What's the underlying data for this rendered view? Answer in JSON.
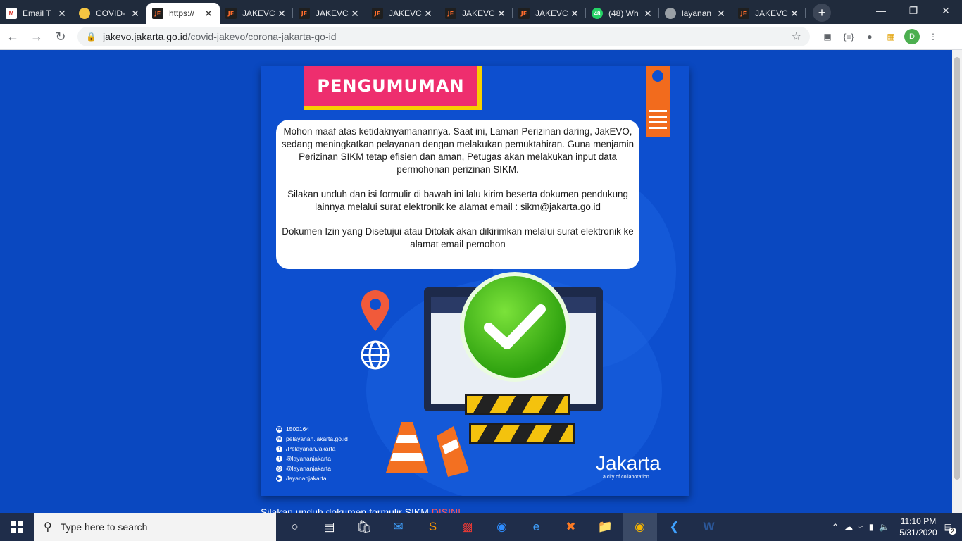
{
  "tabs": [
    {
      "title": "Email T",
      "icon": "gmail-icon",
      "fav": "M",
      "active": false
    },
    {
      "title": "COVID-",
      "icon": "jakarta-seal-icon",
      "fav": "",
      "active": false
    },
    {
      "title": "https://",
      "icon": "jakevo-icon",
      "fav": "JE",
      "active": true
    },
    {
      "title": "JAKEVC",
      "icon": "jakevo-icon",
      "fav": "JE",
      "active": false
    },
    {
      "title": "JAKEVC",
      "icon": "jakevo-icon",
      "fav": "JE",
      "active": false
    },
    {
      "title": "JAKEVC",
      "icon": "jakevo-icon",
      "fav": "JE",
      "active": false
    },
    {
      "title": "JAKEVC",
      "icon": "jakevo-icon",
      "fav": "JE",
      "active": false
    },
    {
      "title": "JAKEVC",
      "icon": "jakevo-icon",
      "fav": "JE",
      "active": false
    },
    {
      "title": "(48) Wh",
      "icon": "whatsapp-icon",
      "fav": "48",
      "active": false
    },
    {
      "title": "layanan",
      "icon": "globe-icon",
      "fav": "",
      "active": false
    },
    {
      "title": "JAKEVC",
      "icon": "jakevo-icon",
      "fav": "JE",
      "active": false
    }
  ],
  "newtab_label": "+",
  "url": {
    "host": "jakevo.jakarta.go.id",
    "path": "/covid-jakevo/corona-jakarta-go-id"
  },
  "profile_initial": "D",
  "poster": {
    "banner": "PENGUMUMAN",
    "paragraphs": [
      "Mohon maaf atas ketidaknyamanannya. Saat ini, Laman Perizinan daring, JakEVO, sedang meningkatkan pelayanan dengan melakukan pemuktahiran. Guna menjamin Perizinan SIKM tetap efisien dan aman, Petugas akan melakukan input data permohonan perizinan SIKM.",
      "Silakan unduh dan isi formulir di bawah ini lalu kirim beserta dokumen pendukung lainnya melalui surat elektronik ke alamat email : sikm@jakarta.go.id",
      "Dokumen Izin yang Disetujui atau Ditolak akan dikirimkan melalui surat elektronik ke alamat email pemohon"
    ],
    "contacts": [
      {
        "icon": "phone-icon",
        "glyph": "☎",
        "text": "1500164"
      },
      {
        "icon": "web-icon",
        "glyph": "⊕",
        "text": "pelayanan.jakarta.go.id"
      },
      {
        "icon": "facebook-icon",
        "glyph": "f",
        "text": "/PelayananJakarta"
      },
      {
        "icon": "twitter-icon",
        "glyph": "t",
        "text": "@layananjakarta"
      },
      {
        "icon": "instagram-icon",
        "glyph": "◎",
        "text": "@layananjakarta"
      },
      {
        "icon": "youtube-icon",
        "glyph": "▶",
        "text": "/layananjakarta"
      }
    ],
    "brand_name": "Jakarta",
    "brand_tagline": "a city of collaboration"
  },
  "below_text": "Silakan unduh dokumen formulir SIKM",
  "below_link": "DISINI",
  "taskbar": {
    "search_placeholder": "Type here to search",
    "time": "11:10 PM",
    "date": "5/31/2020",
    "notification_count": "2"
  }
}
